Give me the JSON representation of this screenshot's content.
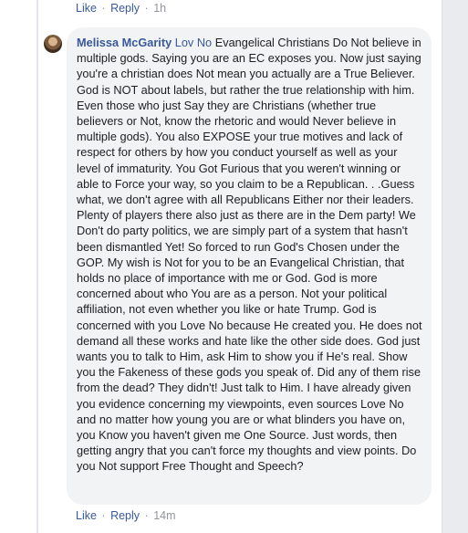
{
  "top_actions": {
    "like_label": "Like",
    "reply_label": "Reply",
    "separator": "·",
    "timestamp": "1h"
  },
  "comment": {
    "author": "Melissa McGarity",
    "mention": "Lov No",
    "text": "Evangelical Christians Do Not believe in multiple gods. Saying you are an EC exposes you. Now just saying you're a christian does Not mean you actually are a True Believer. God is NOT about labels, but rather the true relationship with him. Even those who just Say they are Christians (whether true believers or Not, know the rhetoric and would Never believe in multiple gods). You also EXPOSE your true motives and lack of respect for others by how you conduct yourself as well as your level of immaturity. You Got Furious that you weren't winning or able to Force your way, so you claim to be a Republican. . .Guess what, we don't agree with all Republicans Either nor their leaders. Plenty of players there also just as there are in the Dem party! We Don't do party politics, we are simply part of a system that hasn't been dismantled Yet! So forced to run God's Chosen under the GOP. My wish is Not for you to be an Evangelical Christian, that holds no place of importance with me or God. God is more concerned about who You are as a person. Not your political affiliation, not even whether you like or hate Trump. God is concerned with you Love No because He created you. He does not demand all these works and hate like the other side does. God just wants you to talk to Him, ask Him to show you if He's real. Show you the Fakeness of these gods you speak of. Did any of them rise from the dead? They didn't! Just talk to Him. I have already given you evidence concerning my viewpoints, even sources Love No and no matter how young you are or what blinders you have on, you Know you haven't given me One Source. Just words, then getting angry that you can't force my thoughts and view points. Do you Not support Free Thought and Speech?"
  },
  "bottom_actions": {
    "like_label": "Like",
    "reply_label": "Reply",
    "separator": "·",
    "timestamp": "14m"
  }
}
